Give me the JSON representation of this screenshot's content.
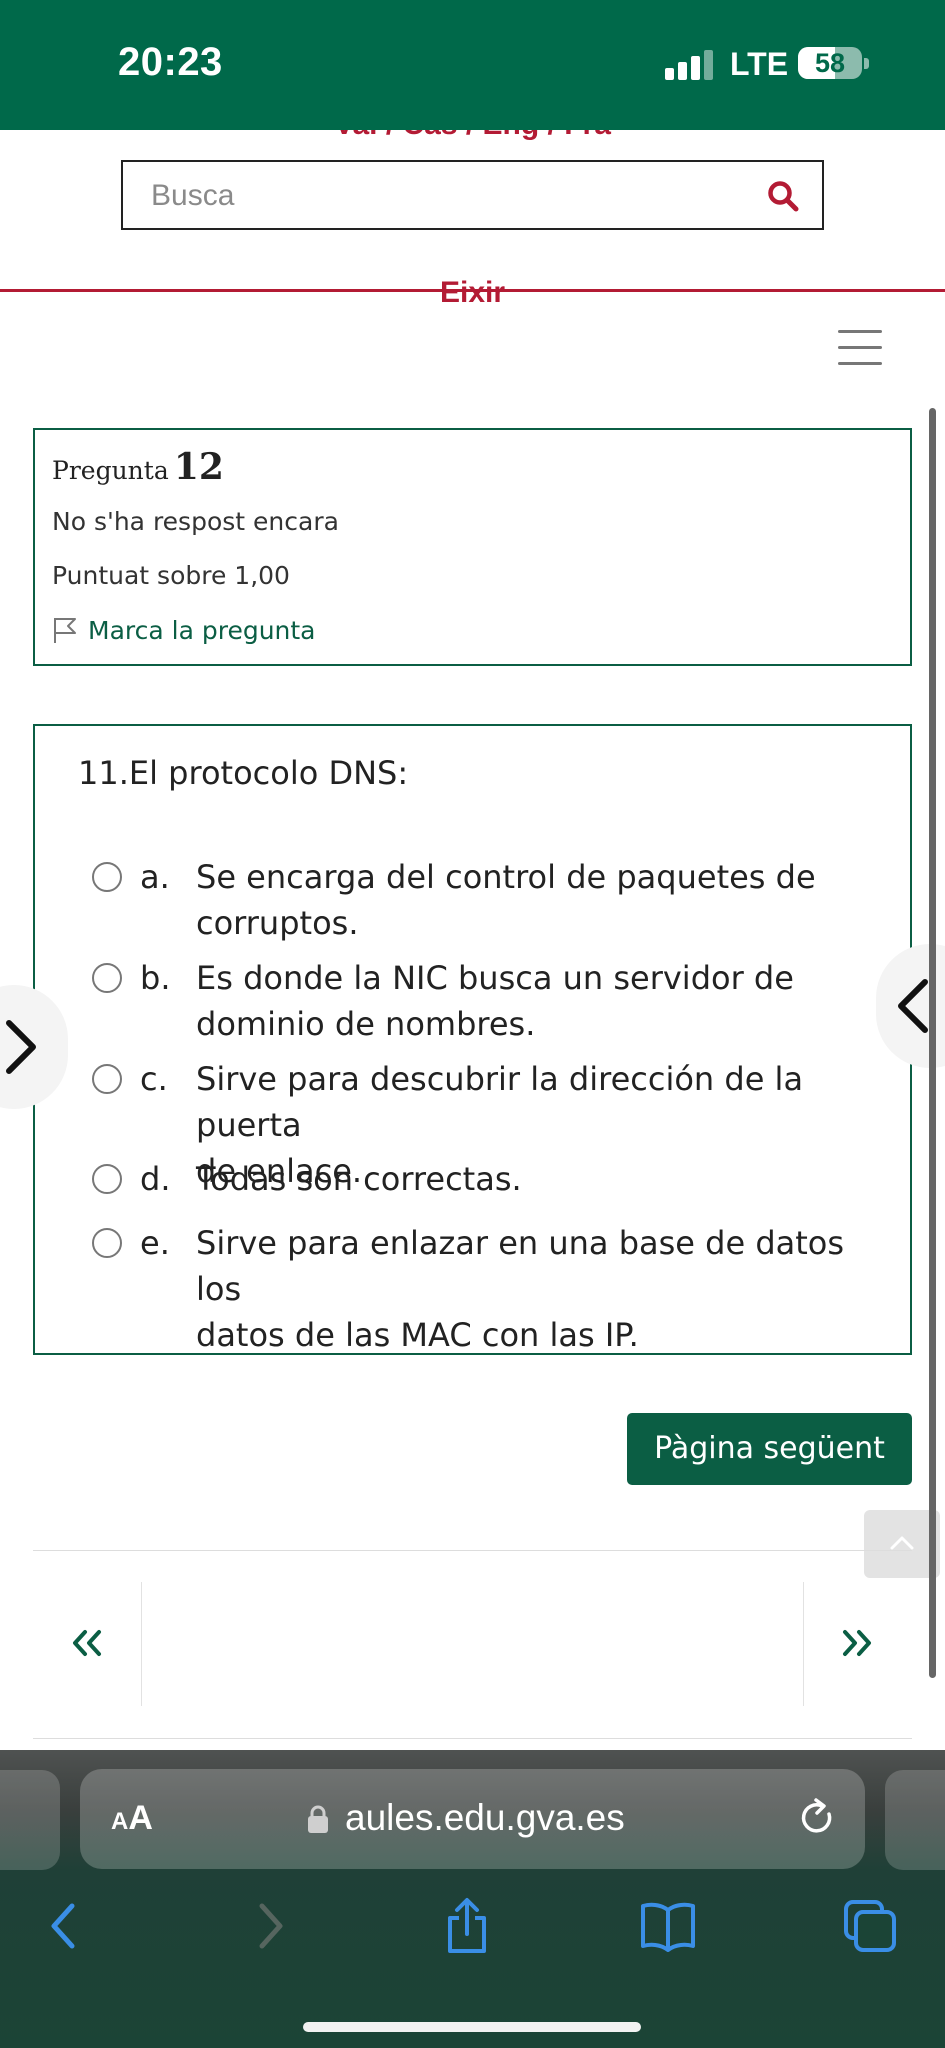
{
  "status_bar": {
    "time": "20:23",
    "network": "LTE",
    "battery_percent": "58",
    "battery_level": 0.58,
    "signal_bars_active": 3,
    "signal_bars_total": 4
  },
  "header": {
    "languages": "Val / Cas / Eng / Fra",
    "search_placeholder": "Busca",
    "exit_label": "Eixir"
  },
  "question_info": {
    "label": "Pregunta",
    "number": "12",
    "status": "No s'ha respost encara",
    "score": "Puntuat sobre 1,00",
    "flag_label": "Marca la pregunta"
  },
  "question": {
    "text": "11.El protocolo DNS:",
    "answers": [
      {
        "letter": "a.",
        "line1": "Se encarga del control de paquetes de",
        "line2": "corruptos.",
        "selected": false
      },
      {
        "letter": "b.",
        "line1": "Es donde la NIC busca un servidor de",
        "line2": "dominio de nombres.",
        "selected": false
      },
      {
        "letter": "c.",
        "line1": "Sirve para descubrir la dirección de la puerta",
        "line2": "de enlace.",
        "selected": false
      },
      {
        "letter": "d.",
        "line1": "Todas son correctas.",
        "line2": "",
        "selected": false
      },
      {
        "letter": "e.",
        "line1": "Sirve para enlazar en una base de datos los",
        "line2": "datos de las MAC con las IP.",
        "selected": false
      }
    ]
  },
  "navigation": {
    "next_page_label": "Pàgina següent",
    "prev_symbol": "«",
    "next_symbol": "»"
  },
  "browser": {
    "aa_small": "A",
    "aa_big": "A",
    "url": "aules.edu.gva.es"
  },
  "colors": {
    "brand_green": "#00694a",
    "accent_red": "#b31b34",
    "button_green": "#0b5e44",
    "ios_blue": "#3a8ee6"
  },
  "icons": [
    "search-icon",
    "hamburger-icon",
    "flag-icon",
    "chevron-right-icon",
    "chevron-left-icon",
    "chevron-up-icon",
    "double-chevron-left-icon",
    "double-chevron-right-icon",
    "lock-icon",
    "reload-icon",
    "back-icon",
    "forward-icon",
    "share-icon",
    "bookmarks-icon",
    "tabs-icon"
  ]
}
